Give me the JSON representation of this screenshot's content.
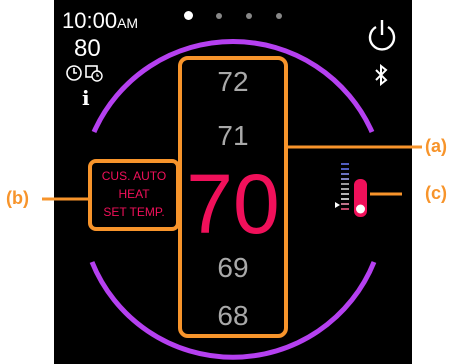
{
  "status": {
    "time": "10:00",
    "time_suffix": "AM",
    "outdoor_temp": "80"
  },
  "pager": {
    "total": 5,
    "active": 1
  },
  "setpoint": {
    "values": [
      "72",
      "71",
      "70",
      "69",
      "68"
    ],
    "current": "70"
  },
  "mode": {
    "line1": "CUS. AUTO",
    "line2": "HEAT",
    "line3": "SET TEMP."
  },
  "callouts": {
    "a": "(a)",
    "b": "(b)",
    "c": "(c)"
  },
  "icons": {
    "schedule": "schedule-icon",
    "info": "info-icon",
    "power": "power-icon",
    "bluetooth": "bluetooth-icon"
  },
  "colors": {
    "accent_orange": "#f7942b",
    "setpoint_red": "#f0105a",
    "ring_purple": "#b540f0",
    "background": "#000000"
  }
}
